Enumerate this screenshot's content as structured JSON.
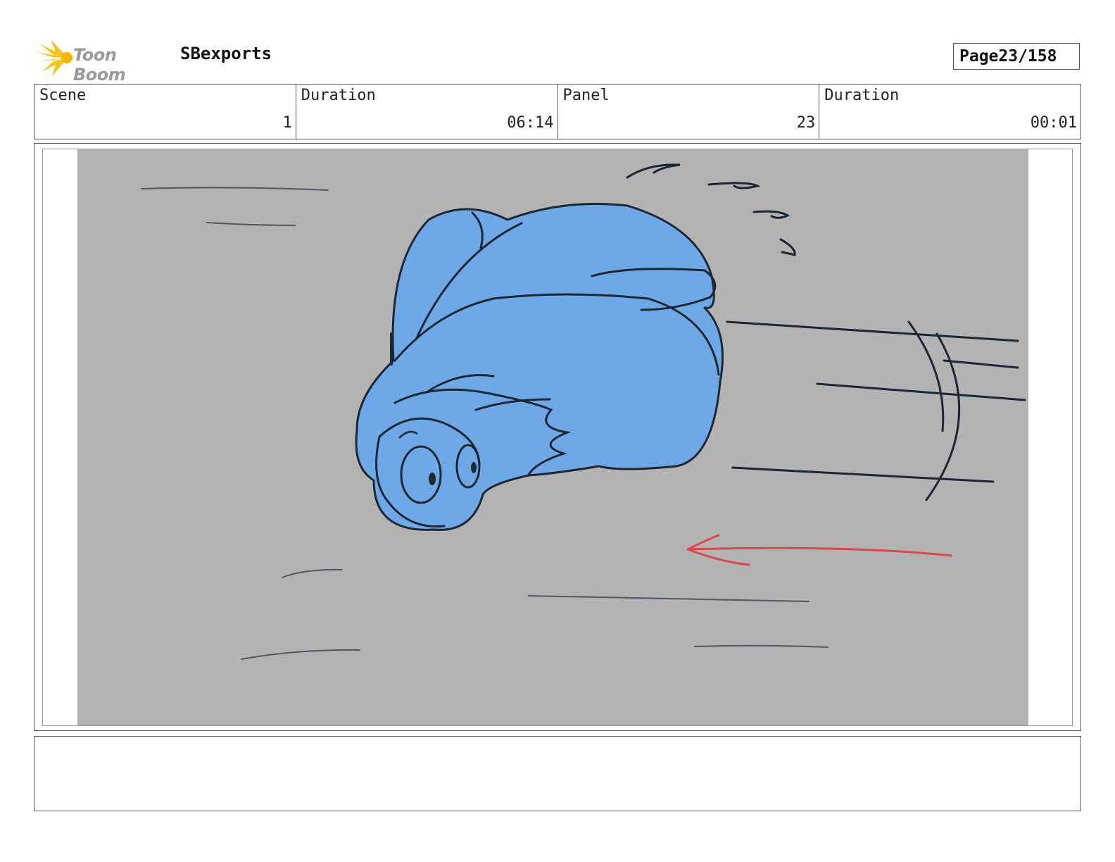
{
  "header": {
    "logo_text": "Toon Boom",
    "project_name": "SBexports",
    "page_label": "Page",
    "page_value": "23/158"
  },
  "info": {
    "scene_label": "Scene",
    "scene_value": "1",
    "scene_duration_label": "Duration",
    "scene_duration_value": "06:14",
    "panel_label": "Panel",
    "panel_value": "23",
    "panel_duration_label": "Duration",
    "panel_duration_value": "00:01"
  },
  "notes": {
    "text": ""
  },
  "colors": {
    "background_fill": "#b3b3b3",
    "character_fill": "#6fa8e6",
    "ink": "#1c2733",
    "arrow": "#d9484f",
    "logo_yellow": "#f5c518"
  },
  "icons": {
    "logo": "toon-boom-star-burst"
  }
}
